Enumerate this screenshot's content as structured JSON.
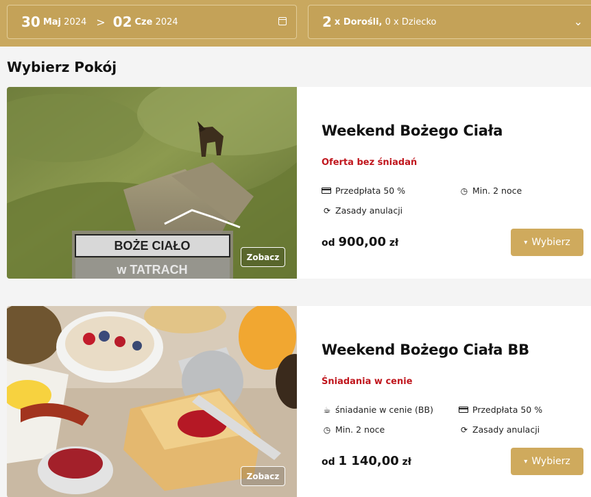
{
  "search": {
    "checkin_day": "30",
    "checkin_month_year_month": "Maj",
    "checkin_year": "2024",
    "separator": ">",
    "checkout_day": "02",
    "checkout_month": "Cze",
    "checkout_year": "2024",
    "adults_count": "2",
    "adults_label": "x Dorośli,",
    "children_label": "0 x Dziecko"
  },
  "page": {
    "title": "Wybierz Pokój"
  },
  "rooms": [
    {
      "name": "Weekend Bożego Ciała",
      "offer": "Oferta bez śniadań",
      "features": [
        "Przedpłata 50 %",
        "Min. 2 noce",
        "Zasady anulacji"
      ],
      "price_prefix": "od",
      "price": "900,00",
      "currency": "zł",
      "view_label": "Zobacz",
      "select_label": "Wybierz",
      "photo_text_line1": "BOŻE CIAŁO",
      "photo_text_line2": "w TATRACH"
    },
    {
      "name": "Weekend Bożego Ciała BB",
      "offer": "Śniadania w cenie",
      "features": [
        "śniadanie w cenie (BB)",
        "Przedpłata 50 %",
        "Min. 2 noce",
        "Zasady anulacji"
      ],
      "price_prefix": "od",
      "price": "1 140,00",
      "currency": "zł",
      "view_label": "Zobacz",
      "select_label": "Wybierz"
    }
  ],
  "colors": {
    "header_bg": "#c9a85f",
    "button_bg": "#cfaa5d",
    "offer_red": "#c0161d"
  }
}
